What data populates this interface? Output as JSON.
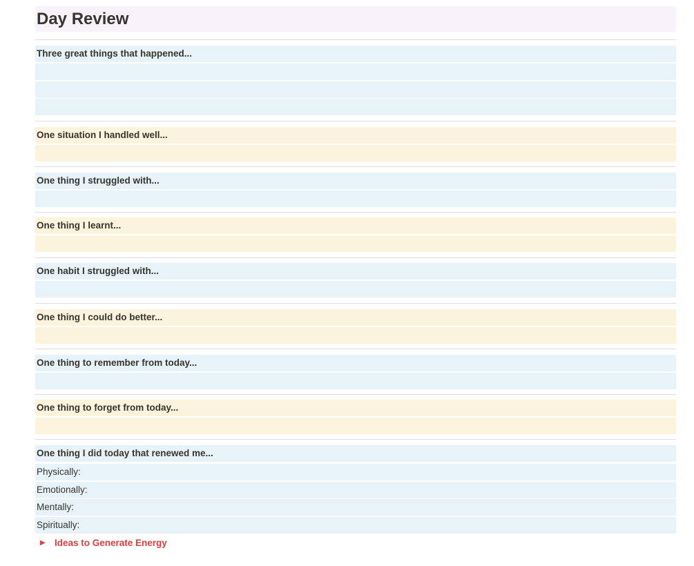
{
  "page": {
    "title": "Day Review"
  },
  "sections": {
    "great_things": {
      "heading": "Three great things that happened..."
    },
    "handled_well": {
      "heading": "One situation I handled well..."
    },
    "struggled": {
      "heading": "One thing I struggled with..."
    },
    "learnt": {
      "heading": "One thing I learnt..."
    },
    "habit": {
      "heading": "One habit I struggled with..."
    },
    "do_better": {
      "heading": "One thing I could do better..."
    },
    "remember": {
      "heading": "One thing to remember from today..."
    },
    "forget": {
      "heading": "One thing to forget from today..."
    },
    "renewed": {
      "heading": "One thing I did today that renewed me...",
      "items": [
        "Physically:",
        "Emotionally:",
        "Mentally:",
        "Spiritually:"
      ]
    }
  },
  "toggle": {
    "label": "Ideas to Generate Energy",
    "icon": "triangle-right-icon"
  },
  "colors": {
    "title_bg": "#f8f3fa",
    "blue_bg": "#e7f3f8",
    "yellow_bg": "#fbf3db",
    "toggle_text": "#e03e3e",
    "text": "#37352f"
  }
}
